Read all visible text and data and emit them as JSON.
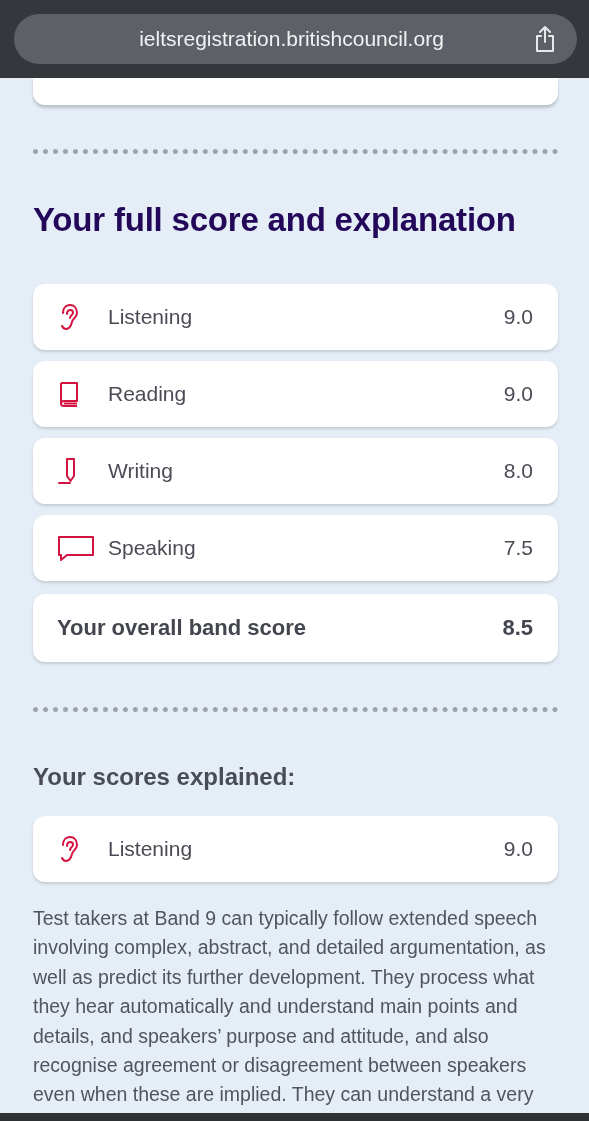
{
  "browser": {
    "url": "ieltsregistration.britishcouncil.org"
  },
  "full_score": {
    "title": "Your full score and explanation",
    "rows": [
      {
        "kind": "skill",
        "label": "Listening",
        "score": "9.0"
      },
      {
        "kind": "skill",
        "label": "Reading",
        "score": "9.0"
      },
      {
        "kind": "skill",
        "label": "Writing",
        "score": "8.0"
      },
      {
        "kind": "skill",
        "label": "Speaking",
        "score": "7.5"
      },
      {
        "kind": "total",
        "label": "Your overall band score",
        "score": "8.5"
      }
    ]
  },
  "explained": {
    "title": "Your scores explained:",
    "row": {
      "label": "Listening",
      "score": "9.0"
    },
    "paragraph_lines": [
      "Test takers at Band 9 can typically follow extended speech",
      "involving complex, abstract, and detailed argumentation, as",
      "well as predict its further development. They process what",
      "they hear automatically and understand main points and",
      "details, and speakers’ purpose and attitude, and also",
      "recognise agreement or disagreement between speakers",
      "even when these are implied. They can understand a very"
    ]
  }
}
